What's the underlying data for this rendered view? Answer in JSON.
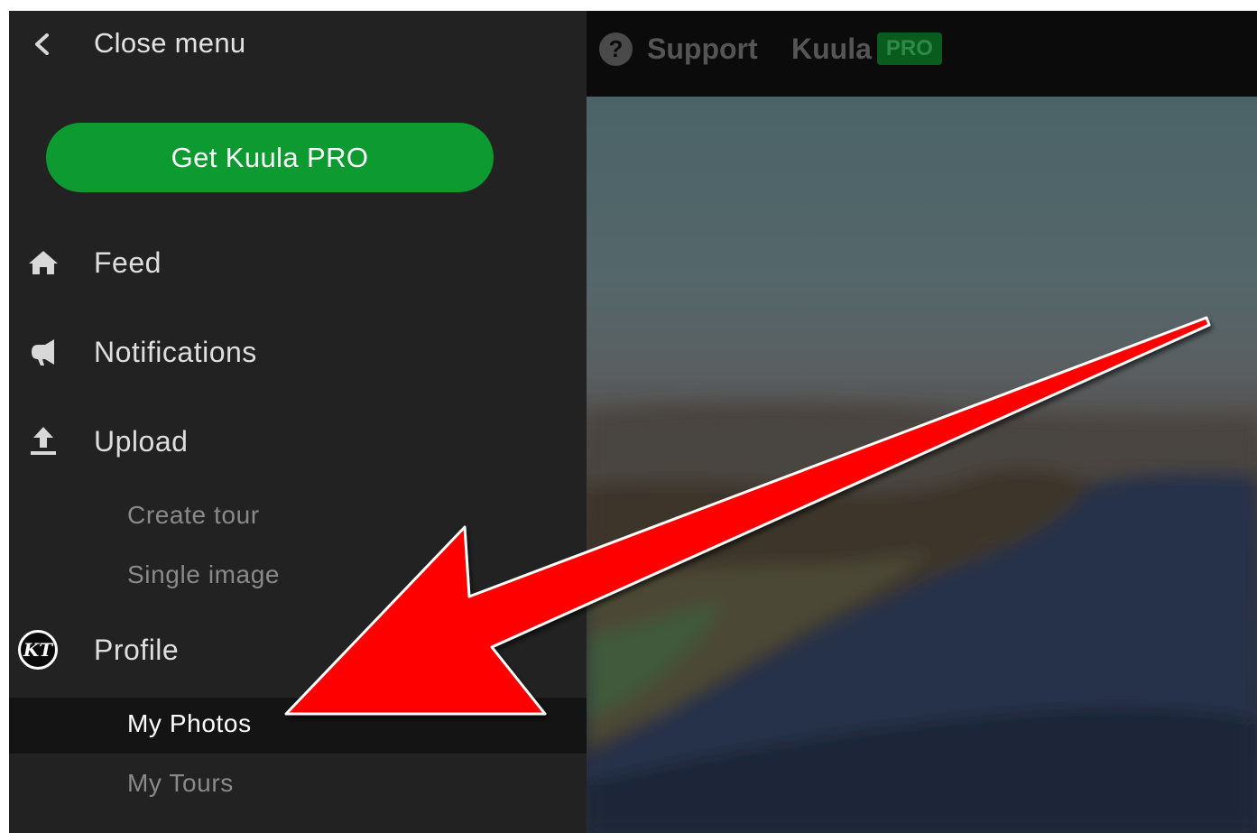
{
  "sidebar": {
    "close_label": "Close menu",
    "cta_label": "Get Kuula PRO",
    "items": [
      {
        "label": "Feed",
        "icon": "home-icon"
      },
      {
        "label": "Notifications",
        "icon": "megaphone-icon"
      },
      {
        "label": "Upload",
        "icon": "upload-icon"
      }
    ],
    "upload_sub": [
      "Create tour",
      "Single image"
    ],
    "profile": {
      "label": "Profile",
      "avatar_text": "KT"
    },
    "profile_sub": [
      "My Photos",
      "My Tours"
    ],
    "active_item": "My Photos"
  },
  "topbar": {
    "support_label": "Support",
    "help_glyph": "?",
    "brand": "Kuula",
    "badge": "PRO"
  },
  "colors": {
    "sidebar_bg": "#222222",
    "cta_green": "#0d9a30",
    "annotation_arrow": "#ff0000"
  }
}
